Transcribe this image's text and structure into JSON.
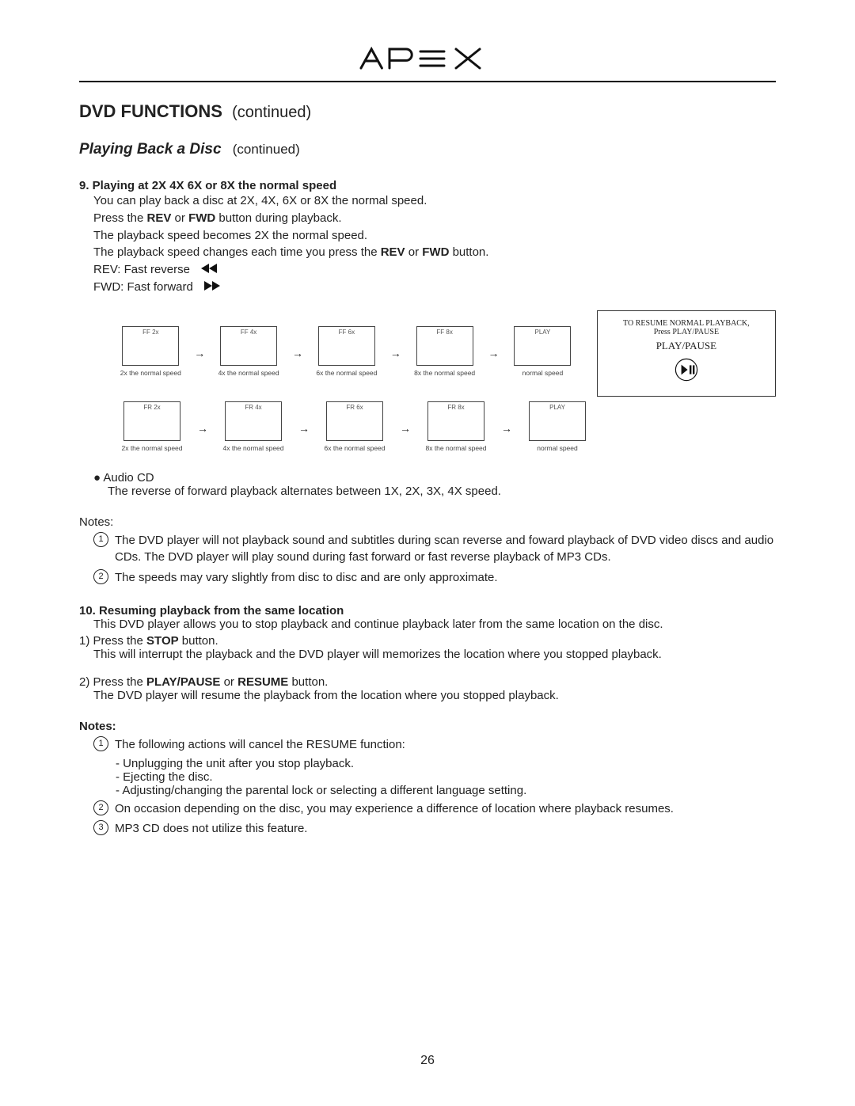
{
  "brand": "APEX",
  "section": {
    "title": "DVD FUNCTIONS",
    "cont": "(continued)"
  },
  "subsection": {
    "title": "Playing Back a Disc",
    "cont": "(continued)"
  },
  "sec9": {
    "heading": "9. Playing at 2X 4X 6X or 8X the normal speed",
    "l1": "You can play back a disc at 2X, 4X, 6X or 8X the normal speed.",
    "l2a": "Press the ",
    "l2b": "REV",
    "l2c": " or ",
    "l2d": "FWD",
    "l2e": " button during playback.",
    "l3": "The playback speed becomes 2X the normal speed.",
    "l4a": "The playback speed changes each time you press the ",
    "l4b": "REV",
    "l4c": " or ",
    "l4d": "FWD",
    "l4e": " button.",
    "l5": "REV: Fast reverse",
    "l6": "FWD: Fast forward"
  },
  "diagram": {
    "ff": {
      "b": [
        "FF 2x",
        "FF 4x",
        "FF 6x",
        "FF 8x",
        "PLAY"
      ],
      "c": [
        "2x the normal speed",
        "4x the normal speed",
        "6x the normal speed",
        "8x the normal speed",
        "normal speed"
      ]
    },
    "fr": {
      "b": [
        "FR 2x",
        "FR 4x",
        "FR 6x",
        "FR 8x",
        "PLAY"
      ],
      "c": [
        "2x the normal speed",
        "4x the normal speed",
        "6x the normal speed",
        "8x the normal speed",
        "normal speed"
      ]
    },
    "resume": {
      "l1": "TO RESUME NORMAL PLAYBACK,",
      "l2": "Press PLAY/PAUSE",
      "l3": "PLAY/PAUSE"
    }
  },
  "audio_cd": {
    "title": "Audio CD",
    "body": "The reverse of forward playback alternates  between 1X, 2X, 3X, 4X speed."
  },
  "notes1": {
    "label": "Notes:",
    "n1": "The DVD player will not playback sound and subtitles during scan reverse and foward playback of DVD video discs and audio CDs. The DVD player will play sound during fast forward or fast reverse playback of MP3 CDs.",
    "n2": "The speeds may vary slightly from disc to disc and are only approximate."
  },
  "sec10": {
    "heading": "10. Resuming playback from the same location",
    "intro": "This DVD player allows you to stop playback and continue playback later from the same location on the disc.",
    "s1a": "1) Press the ",
    "s1b": "STOP",
    "s1c": " button.",
    "s1d": "This will interrupt the playback and the DVD player will memorizes the location where you stopped playback.",
    "s2a": "2) Press the ",
    "s2b": "PLAY/PAUSE",
    "s2c": " or ",
    "s2d": "RESUME",
    "s2e": " button.",
    "s2f": "The DVD player will resume the playback from the location where you stopped playback."
  },
  "notes2": {
    "label": "Notes:",
    "n1": "The following actions will cancel the RESUME function:",
    "n1a": "- Unplugging the unit after you stop playback.",
    "n1b": "- Ejecting the disc.",
    "n1c": "- Adjusting/changing the parental lock or selecting a different language setting.",
    "n2": "On occasion depending on the disc, you may experience a difference of location where playback resumes.",
    "n3": "MP3 CD does not utilize this feature."
  },
  "page_number": "26"
}
